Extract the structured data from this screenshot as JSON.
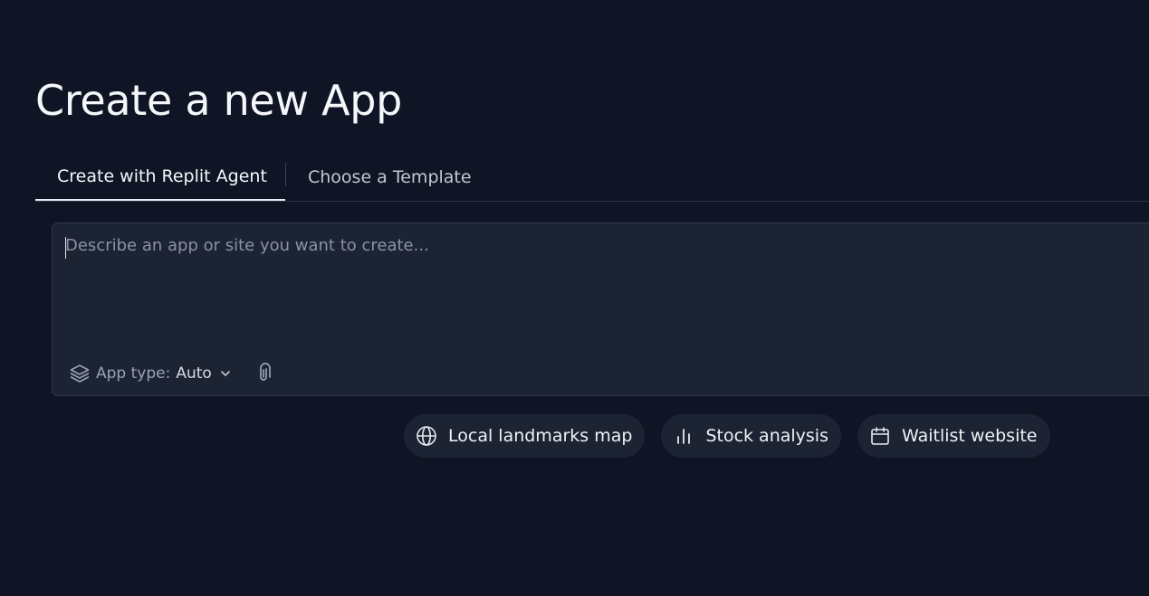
{
  "page": {
    "title": "Create a new App"
  },
  "tabs": [
    {
      "label": "Create with Replit Agent",
      "active": true
    },
    {
      "label": "Choose a Template",
      "active": false
    }
  ],
  "prompt": {
    "placeholder": "Describe an app or site you want to create...",
    "value": ""
  },
  "app_type": {
    "label": "App type:",
    "value": "Auto",
    "icon": "layers-icon"
  },
  "attach": {
    "icon": "paperclip-icon"
  },
  "suggestions": [
    {
      "label": "Local landmarks map",
      "icon": "globe-icon"
    },
    {
      "label": "Stock analysis",
      "icon": "bar-chart-icon"
    },
    {
      "label": "Waitlist website",
      "icon": "calendar-icon"
    }
  ],
  "colors": {
    "background": "#0f1524",
    "surface": "#1c2333",
    "border": "#2f3749",
    "text": "#f5f7fa",
    "muted": "#8a92a3"
  }
}
